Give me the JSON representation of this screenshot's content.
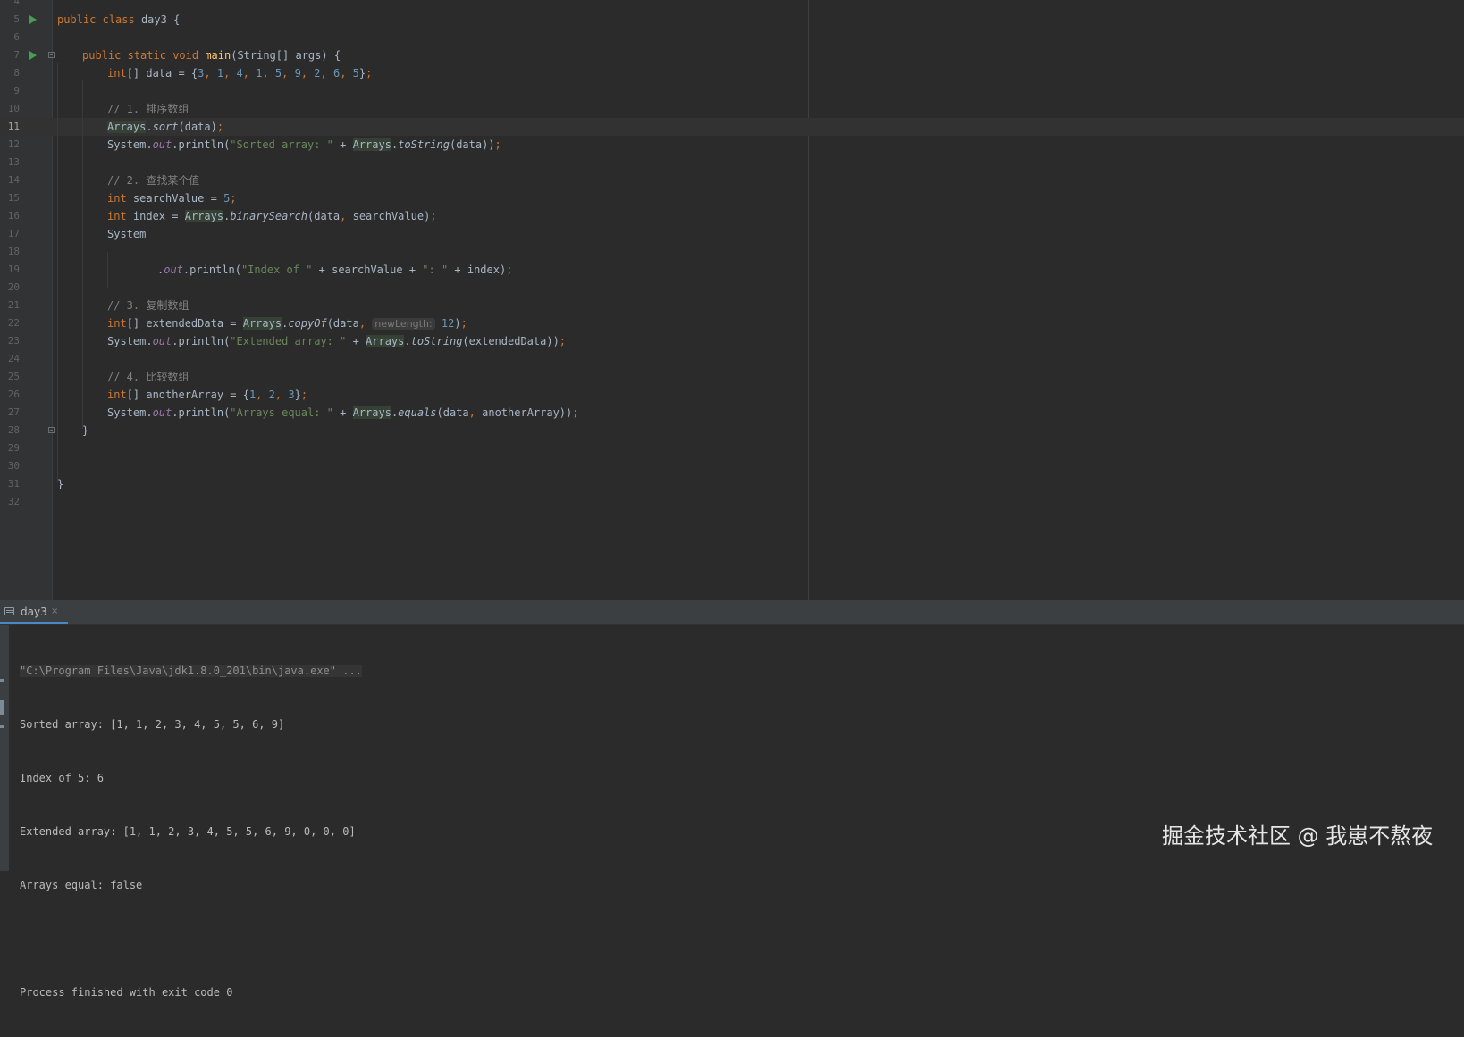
{
  "editor": {
    "lines": [
      {
        "no": "4"
      },
      {
        "no": "5",
        "run": true
      },
      {
        "no": "6"
      },
      {
        "no": "7",
        "run": true,
        "fold": true
      },
      {
        "no": "8"
      },
      {
        "no": "9"
      },
      {
        "no": "10"
      },
      {
        "no": "11",
        "current": true
      },
      {
        "no": "12"
      },
      {
        "no": "13"
      },
      {
        "no": "14"
      },
      {
        "no": "15"
      },
      {
        "no": "16"
      },
      {
        "no": "17"
      },
      {
        "no": "18"
      },
      {
        "no": "19"
      },
      {
        "no": "20"
      },
      {
        "no": "21"
      },
      {
        "no": "22"
      },
      {
        "no": "23"
      },
      {
        "no": "24"
      },
      {
        "no": "25"
      },
      {
        "no": "26"
      },
      {
        "no": "27"
      },
      {
        "no": "28",
        "fold": true
      },
      {
        "no": "29"
      },
      {
        "no": "30"
      },
      {
        "no": "31"
      },
      {
        "no": "32"
      }
    ],
    "code": {
      "l5": {
        "kw1": "public",
        "kw2": "class",
        "name": "day3",
        "brace": "{"
      },
      "l7": {
        "kw1": "public",
        "kw2": "static",
        "kw3": "void",
        "fn": "main",
        "params": "(String[] args) {"
      },
      "l8": {
        "type": "int",
        "rest": "[] data = {",
        "n1": "3",
        "n2": "1",
        "n3": "4",
        "n4": "1",
        "n5": "5",
        "n6": "9",
        "n7": "2",
        "n8": "6",
        "n9": "5",
        "end": "}"
      },
      "l10": {
        "comment": "// 1. 排序数组"
      },
      "l11": {
        "cls": "Arrays",
        "dot": ".",
        "method": "sort",
        "args": "(data)"
      },
      "l12": {
        "sys": "System.",
        "out": "out",
        "call": ".println(",
        "str": "\"Sorted array: \"",
        "plus": " + ",
        "cls": "Arrays",
        "dot": ".",
        "method": "toString",
        "args": "(data))"
      },
      "l14": {
        "comment": "// 2. 查找某个值"
      },
      "l15": {
        "type": "int",
        "rest": " searchValue = ",
        "n": "5"
      },
      "l16": {
        "type": "int",
        "rest": " index = ",
        "cls": "Arrays",
        "dot": ".",
        "method": "binarySearch",
        "args": "(data",
        "args2": " searchValue)"
      },
      "l17": {
        "sys": "System"
      },
      "l19": {
        "dot": ".",
        "out": "out",
        "call": ".println(",
        "str1": "\"Index of \"",
        "mid": " + searchValue + ",
        "str2": "\": \"",
        "tail": " + index)"
      },
      "l21": {
        "comment": "// 3. 复制数组"
      },
      "l22": {
        "type": "int",
        "rest": "[] extendedData = ",
        "cls": "Arrays",
        "dot": ".",
        "method": "copyOf",
        "args": "(data",
        "hint": "newLength:",
        "n": "12",
        "close": ")"
      },
      "l23": {
        "sys": "System.",
        "out": "out",
        "call": ".println(",
        "str": "\"Extended array: \"",
        "plus": " + ",
        "cls": "Arrays",
        "dot": ".",
        "method": "toString",
        "args": "(extendedData))"
      },
      "l25": {
        "comment": "// 4. 比较数组"
      },
      "l26": {
        "type": "int",
        "rest": "[] anotherArray = {",
        "n1": "1",
        "n2": "2",
        "n3": "3",
        "end": "}"
      },
      "l27": {
        "sys": "System.",
        "out": "out",
        "call": ".println(",
        "str": "\"Arrays equal: \"",
        "plus": " + ",
        "cls": "Arrays",
        "dot": ".",
        "method": "equals",
        "args": "(data",
        "args2": " anotherArray))"
      },
      "l28": {
        "brace": "}"
      },
      "l31": {
        "brace": "}"
      }
    }
  },
  "run_panel": {
    "tab_label": "day3",
    "tab_close": "×",
    "console": {
      "command": "\"C:\\Program Files\\Java\\jdk1.8.0_201\\bin\\java.exe\" ...",
      "out1": "Sorted array: [1, 1, 2, 3, 4, 5, 5, 6, 9]",
      "out2": "Index of 5: 6",
      "out3": "Extended array: [1, 1, 2, 3, 4, 5, 5, 6, 9, 0, 0, 0]",
      "out4": "Arrays equal: false",
      "out5": "Process finished with exit code 0"
    }
  },
  "watermark": "掘金技术社区 @ 我崽不熬夜",
  "colors": {
    "keyword": "#cc7832",
    "number": "#6897bb",
    "string": "#6a8759",
    "comment": "#808080",
    "method": "#ffc66d",
    "static_field": "#9876aa",
    "default_text": "#a9b7c6",
    "run_icon": "#499c54"
  }
}
